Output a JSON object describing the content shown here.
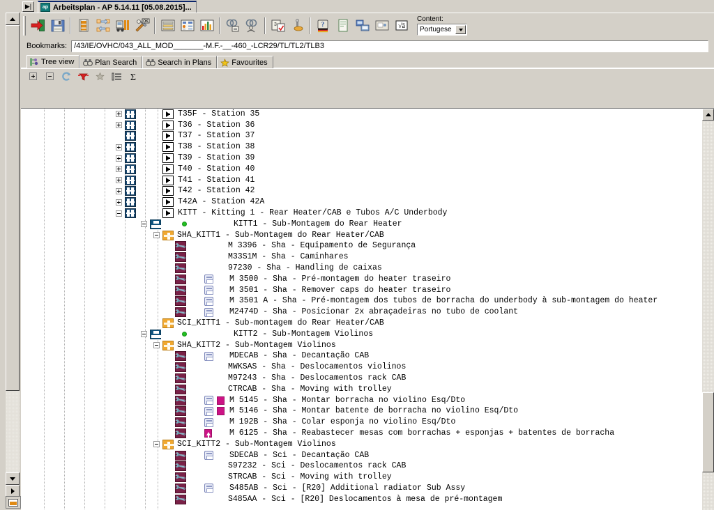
{
  "window": {
    "title": "Arbeitsplan - AP 5.14.11  [05.08.2015]...",
    "app_icon_text": "ap",
    "sysmenu_glyph": "▶≡"
  },
  "toolbar": {
    "buttons": [
      {
        "name": "export-button",
        "label": "Export"
      },
      {
        "name": "save-button",
        "label": "Save"
      },
      {
        "name": "filmstrip-button",
        "label": "Film strip"
      },
      {
        "name": "copy-move-button",
        "label": "Copy / Move"
      },
      {
        "name": "machine-button",
        "label": "Machine"
      },
      {
        "name": "tools-check-button",
        "label": "Tools OK"
      },
      {
        "name": "list-report-button",
        "label": "List report"
      },
      {
        "name": "data-sheet-button",
        "label": "Data sheet"
      },
      {
        "name": "chart-button",
        "label": "Chart"
      },
      {
        "name": "find-group-button",
        "label": "Find group"
      },
      {
        "name": "people-group-button",
        "label": "People group"
      },
      {
        "name": "numbered-check-button",
        "label": "Numbered check"
      },
      {
        "name": "measure-button",
        "label": "Measure"
      },
      {
        "name": "help-flag-button",
        "label": "Help (German)"
      },
      {
        "name": "document-button",
        "label": "Document"
      },
      {
        "name": "network-button",
        "label": "Network"
      },
      {
        "name": "presentation-button",
        "label": "Presentation"
      },
      {
        "name": "formula-button",
        "label": "Formula"
      }
    ],
    "content_label": "Content:",
    "content_value": "Portugese"
  },
  "bookmarks": {
    "label": "Bookmarks:",
    "value": "/43/IE/OVHC/043_ALL_MOD_______-M.F.-__-460_-LCR29/TL/TL2/TLB3"
  },
  "tabs": [
    {
      "label": "Tree view",
      "icon": "tree-icon",
      "active": true
    },
    {
      "label": "Plan Search",
      "icon": "binoculars-icon",
      "active": false
    },
    {
      "label": "Search in Plans",
      "icon": "binoculars-icon",
      "active": false
    },
    {
      "label": "Favourites",
      "icon": "star-icon",
      "active": false
    }
  ],
  "treebar": {
    "buttons": [
      {
        "name": "expand-all-button",
        "label": "Expand all"
      },
      {
        "name": "collapse-all-button",
        "label": "Collapse all"
      },
      {
        "name": "refresh-button",
        "label": "Refresh"
      },
      {
        "name": "filter-button",
        "label": "Filter"
      },
      {
        "name": "favourite-button",
        "label": "Add favourite"
      },
      {
        "name": "outline-button",
        "label": "Outline"
      },
      {
        "name": "sum-button",
        "label": "Sum"
      }
    ]
  },
  "tree": {
    "guide_columns": [
      33,
      62,
      91,
      120,
      149,
      178,
      196
    ],
    "rows": [
      {
        "indent": 149,
        "expander": "plus",
        "icon": "station-icon",
        "icon2": "arrow-icon",
        "text": "T35F - Station 35"
      },
      {
        "indent": 149,
        "expander": "plus",
        "icon": "station-icon",
        "icon2": "arrow-icon",
        "text": "T36 - Station 36"
      },
      {
        "indent": 149,
        "expander": "none",
        "icon": "station-icon",
        "icon2": "arrow-icon",
        "text": "T37 - Station 37"
      },
      {
        "indent": 149,
        "expander": "plus",
        "icon": "station-icon",
        "icon2": "arrow-icon",
        "text": "T38 - Station 38"
      },
      {
        "indent": 149,
        "expander": "plus",
        "icon": "station-icon",
        "icon2": "arrow-icon",
        "text": "T39 - Station 39"
      },
      {
        "indent": 149,
        "expander": "plus",
        "icon": "station-icon",
        "icon2": "arrow-icon",
        "text": "T40 - Station 40"
      },
      {
        "indent": 149,
        "expander": "plus",
        "icon": "station-icon",
        "icon2": "arrow-icon",
        "text": "T41 - Station 41"
      },
      {
        "indent": 149,
        "expander": "plus",
        "icon": "station-icon",
        "icon2": "arrow-icon",
        "text": "T42 - Station 42"
      },
      {
        "indent": 149,
        "expander": "plus",
        "icon": "station-icon",
        "icon2": "arrow-icon",
        "text": "T42A - Station 42A"
      },
      {
        "indent": 149,
        "expander": "minus",
        "icon": "station-icon",
        "icon2": "arrow-icon",
        "text": "KITT - Kitting 1 - Rear Heater/CAB e Tubos A/C Underbody"
      },
      {
        "indent": 185,
        "expander": "minus",
        "icon": "press-icon",
        "icon2": "green-dot",
        "text": "KITT1 - Sub-Montagem do Rear Heater"
      },
      {
        "indent": 203,
        "expander": "minus",
        "icon": "orange-icon",
        "icon2": "none",
        "text": "SHA_KITT1 - Sub-Montagem do Rear Heater/CAB"
      },
      {
        "indent": 221,
        "expander": "none",
        "icon": "wrench-icon",
        "icon2": "none",
        "text": "M 3396 - Sha - Equipamento de Segurança"
      },
      {
        "indent": 221,
        "expander": "none",
        "icon": "wrench-icon",
        "icon2": "none",
        "text": "M33S1M - Sha - Caminhares"
      },
      {
        "indent": 221,
        "expander": "none",
        "icon": "wrench-icon",
        "icon2": "none",
        "text": "97230 - Sha - Handling de caixas"
      },
      {
        "indent": 221,
        "expander": "none",
        "icon": "wrench-icon",
        "icon2": "doc-icon",
        "text": "M 3500 - Sha - Pré-montagem do heater traseiro"
      },
      {
        "indent": 221,
        "expander": "none",
        "icon": "wrench-icon",
        "icon2": "doc-icon",
        "text": "M 3501 - Sha - Remover caps do heater traseiro"
      },
      {
        "indent": 221,
        "expander": "none",
        "icon": "wrench-icon",
        "icon2": "doc-icon",
        "text": "M 3501 A - Sha - Pré-montagem dos tubos de borracha do underbody à sub-montagem do heater"
      },
      {
        "indent": 221,
        "expander": "none",
        "icon": "wrench-icon",
        "icon2": "doc-icon",
        "text": "M2474D - Sha - Posicionar 2x abraçadeiras no tubo de coolant"
      },
      {
        "indent": 203,
        "expander": "none",
        "icon": "orange-icon",
        "icon2": "none",
        "text": "SCI_KITT1 - Sub-montagem do Rear Heater/CAB"
      },
      {
        "indent": 185,
        "expander": "minus",
        "icon": "press-icon",
        "icon2": "green-dot",
        "text": "KITT2 - Sub-Montagem Violinos"
      },
      {
        "indent": 203,
        "expander": "minus",
        "icon": "orange-icon",
        "icon2": "none",
        "text": "SHA_KITT2 - Sub-Montagem Violinos"
      },
      {
        "indent": 221,
        "expander": "none",
        "icon": "wrench-icon",
        "icon2": "doc-icon",
        "text": "MDECAB - Sha - Decantação CAB"
      },
      {
        "indent": 221,
        "expander": "none",
        "icon": "wrench-icon",
        "icon2": "none",
        "text": "MWKSAS - Sha - Deslocamentos violinos"
      },
      {
        "indent": 221,
        "expander": "none",
        "icon": "wrench-icon",
        "icon2": "none",
        "text": "M97243 - Sha - Deslocamentos rack CAB"
      },
      {
        "indent": 221,
        "expander": "none",
        "icon": "wrench-icon",
        "icon2": "none",
        "text": "CTRCAB - Sha - Moving with trolley"
      },
      {
        "indent": 221,
        "expander": "none",
        "icon": "wrench-icon",
        "icon2": "doc-icon",
        "icon3": "magenta-square",
        "text": "M 5145 - Sha - Montar borracha no violino Esq/Dto"
      },
      {
        "indent": 221,
        "expander": "none",
        "icon": "wrench-icon",
        "icon2": "doc-icon",
        "icon3": "magenta-square",
        "text": "M 5146 - Sha - Montar batente de borracha no violino Esq/Dto"
      },
      {
        "indent": 221,
        "expander": "none",
        "icon": "wrench-icon",
        "icon2": "doc-icon",
        "text": "M 192B - Sha - Colar esponja no violino Esq/Dto"
      },
      {
        "indent": 221,
        "expander": "none",
        "icon": "wrench-icon",
        "icon2": "up-arrow-icon",
        "text": "M 6125 - Sha - Reabastecer mesas com borrachas + esponjas + batentes de borracha"
      },
      {
        "indent": 203,
        "expander": "minus",
        "icon": "orange-icon",
        "icon2": "none",
        "text": "SCI_KITT2 - Sub-Montagem Violinos"
      },
      {
        "indent": 221,
        "expander": "none",
        "icon": "wrench-icon",
        "icon2": "doc-icon",
        "text": "SDECAB - Sci - Decantação CAB"
      },
      {
        "indent": 221,
        "expander": "none",
        "icon": "wrench-icon",
        "icon2": "none",
        "text": "S97232 - Sci - Deslocamentos rack CAB"
      },
      {
        "indent": 221,
        "expander": "none",
        "icon": "wrench-icon",
        "icon2": "none",
        "text": "STRCAB - Sci - Moving with trolley"
      },
      {
        "indent": 221,
        "expander": "none",
        "icon": "wrench-icon",
        "icon2": "doc-icon",
        "text": "S485AB - Sci - [R20] Additional radiator Sub Assy"
      },
      {
        "indent": 221,
        "expander": "none",
        "icon": "wrench-icon",
        "icon2": "none",
        "text": "S485AA - Sci - [R20] Deslocamentos à mesa de pré-montagem"
      }
    ]
  },
  "colors": {
    "window_bg": "#d4d0c8",
    "tree_bg": "#ffffff",
    "title_accent": "#0a246a",
    "station_icon": "#1c4b73",
    "orange_icon": "#f0a830",
    "wrench_icon": "#7a2147",
    "magenta_marker": "#cc1385",
    "green_dot": "#22c022"
  }
}
